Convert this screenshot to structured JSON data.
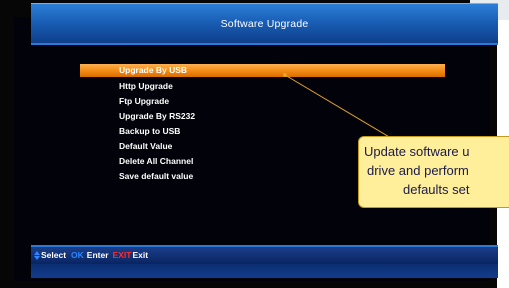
{
  "header": {
    "title": "Software Upgrade"
  },
  "menu": {
    "items": [
      "Upgrade By USB",
      "Http Upgrade",
      "Ftp Upgrade",
      "Upgrade By RS232",
      "Backup to USB",
      "Default Value",
      "Delete All Channel",
      "Save default value"
    ],
    "selected_index": 0
  },
  "callout": {
    "lines": [
      "Update software u",
      "drive and perform",
      "defaults set"
    ]
  },
  "footer": {
    "select_icon": "up-down-arrow-icon",
    "select_label": "Select",
    "ok_key": "OK",
    "enter_label": "Enter",
    "exit_key": "EXIT",
    "exit_label": "Exit"
  },
  "colors": {
    "highlight": "#f28a12",
    "title_bar": "#1a5fb6",
    "callout_bg": "#ffef9a",
    "ok_key": "#2e86ff",
    "exit_key": "#ff2a2a"
  }
}
